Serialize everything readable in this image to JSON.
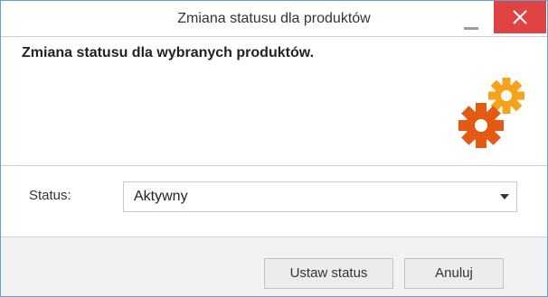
{
  "window": {
    "title": "Zmiana statusu dla produktów"
  },
  "header": {
    "heading": "Zmiana statusu dla wybranych produktów.",
    "icon": "gears-icon",
    "gear_colors": [
      "#f5a31a",
      "#e55a12"
    ]
  },
  "form": {
    "status_label": "Status:",
    "status_value": "Aktywny"
  },
  "footer": {
    "apply_label": "Ustaw status",
    "cancel_label": "Anuluj"
  },
  "colors": {
    "close_button": "#e04343",
    "window_border": "#5ea2d4"
  }
}
